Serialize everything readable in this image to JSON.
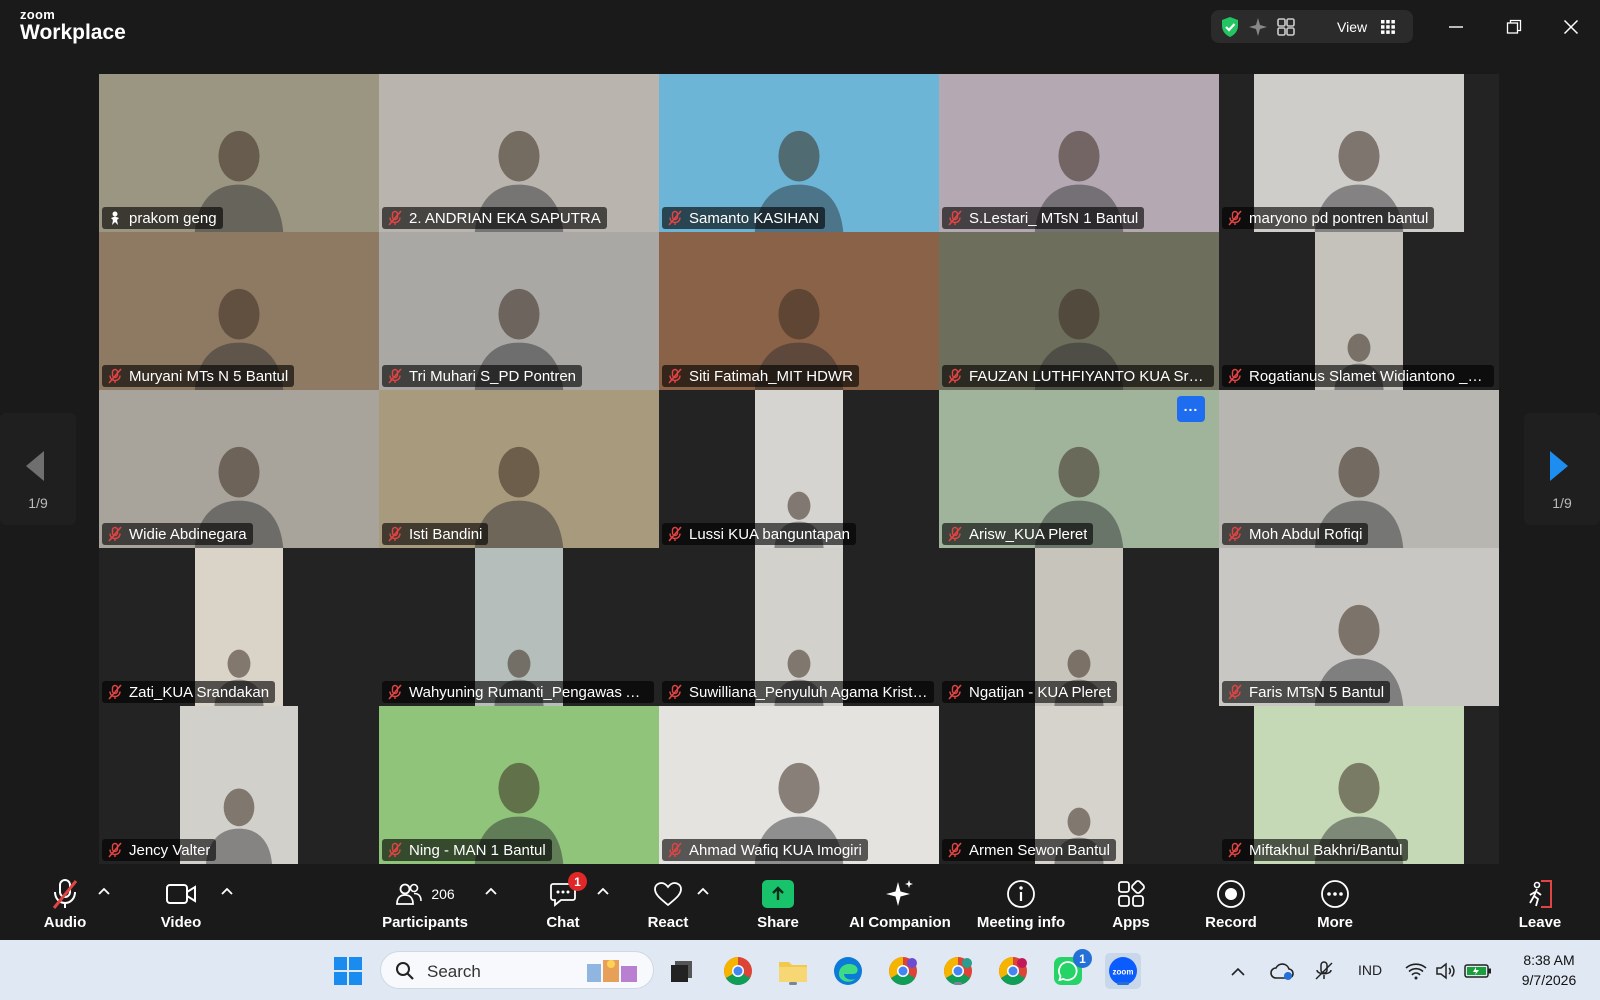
{
  "app": {
    "brand_top": "zoom",
    "brand_bottom": "Workplace"
  },
  "titlebar": {
    "view_label": "View"
  },
  "pager": {
    "left_label": "1/9",
    "right_label": "1/9"
  },
  "tiles": [
    {
      "name": "prakom geng",
      "active": true,
      "mic": "none",
      "bg": "#9b9682",
      "feed": "full"
    },
    {
      "name": "2. ANDRIAN EKA SAPUTRA",
      "mic": "muted",
      "bg": "#b9b5ae",
      "feed": "full"
    },
    {
      "name": "Samanto KASIHAN",
      "mic": "muted",
      "bg": "#6cb5d6",
      "feed": "full"
    },
    {
      "name": "S.Lestari_ MTsN 1 Bantul",
      "mic": "muted",
      "bg": "#b4a9b3",
      "feed": "full"
    },
    {
      "name": "maryono pd pontren bantul",
      "mic": "muted",
      "bg": "#cfcdca",
      "feed": "center-wide"
    },
    {
      "name": "Muryani MTs N 5 Bantul",
      "mic": "muted",
      "bg": "#8e7a63",
      "feed": "full"
    },
    {
      "name": "Tri Muhari S_PD Pontren",
      "mic": "muted",
      "bg": "#a9a8a4",
      "feed": "full"
    },
    {
      "name": "Siti Fatimah_MIT HDWR",
      "mic": "muted",
      "bg": "#8a6248",
      "feed": "full"
    },
    {
      "name": "FAUZAN  LUTHFIYANTO KUA Srandakan",
      "mic": "muted",
      "bg": "#6e6e5c",
      "feed": "full"
    },
    {
      "name": "Rogatianus Slamet Widiantono _Bantul",
      "mic": "muted",
      "bg": "#c4c2bb",
      "feed": "center-narrow"
    },
    {
      "name": "Widie Abdinegara",
      "mic": "muted",
      "bg": "#a8a49b",
      "feed": "full"
    },
    {
      "name": "Isti Bandini",
      "mic": "muted",
      "bg": "#a89a7c",
      "feed": "full"
    },
    {
      "name": "Lussi KUA banguntapan",
      "mic": "muted",
      "bg": "#d6d4d0",
      "feed": "center-narrow"
    },
    {
      "name": "Arisw_KUA Pleret",
      "mic": "muted",
      "bg": "#9fb49b",
      "feed": "full",
      "more": true
    },
    {
      "name": "Moh Abdul Rofiqi",
      "mic": "muted",
      "bg": "#b7b6b0",
      "feed": "full"
    },
    {
      "name": "Zati_KUA Srandakan",
      "mic": "muted",
      "bg": "#d9d3c8",
      "feed": "center-narrow"
    },
    {
      "name": "Wahyuning Rumanti_Pengawas Agama",
      "mic": "muted",
      "bg": "#b5beba",
      "feed": "center-narrow"
    },
    {
      "name": "Suwilliana_Penyuluh Agama Kristen",
      "mic": "muted",
      "bg": "#d3d1cc",
      "feed": "center-narrow"
    },
    {
      "name": "Ngatijan - KUA Pleret",
      "mic": "muted",
      "bg": "#c7c4bb",
      "feed": "center-narrow"
    },
    {
      "name": "Faris MTsN 5  Bantul",
      "mic": "muted",
      "bg": "#c9c7c3",
      "feed": "full"
    },
    {
      "name": "Jency Valter",
      "mic": "muted",
      "bg": "#d2d0cb",
      "feed": "center-mid"
    },
    {
      "name": "Ning - MAN 1 Bantul",
      "mic": "muted",
      "bg": "#8fc47a",
      "feed": "full"
    },
    {
      "name": "Ahmad Wafiq KUA Imogiri",
      "mic": "muted",
      "bg": "#e4e3e0",
      "feed": "full"
    },
    {
      "name": "Armen Sewon Bantul",
      "mic": "muted",
      "bg": "#d6d3cd",
      "feed": "center-narrow"
    },
    {
      "name": "Miftakhul Bakhri/Bantul",
      "mic": "muted",
      "bg": "#c6d9b6",
      "feed": "center-wide"
    }
  ],
  "toolbar": {
    "audio": "Audio",
    "video": "Video",
    "participants": "Participants",
    "participants_count": "206",
    "chat": "Chat",
    "chat_badge": "1",
    "react": "React",
    "share": "Share",
    "ai_companion": "AI Companion",
    "meeting_info": "Meeting info",
    "apps": "Apps",
    "record": "Record",
    "more": "More",
    "leave": "Leave"
  },
  "taskbar": {
    "search_placeholder": "Search",
    "whatsapp_badge": "1",
    "language": "IND",
    "time": "8:38 AM",
    "date": "9/7/2026"
  },
  "colors": {
    "active_speaker": "#23d97e",
    "share_green": "#18c36b",
    "leave_red": "#e24444",
    "muted_red": "#e24444",
    "accent_blue": "#1e6cf0"
  }
}
